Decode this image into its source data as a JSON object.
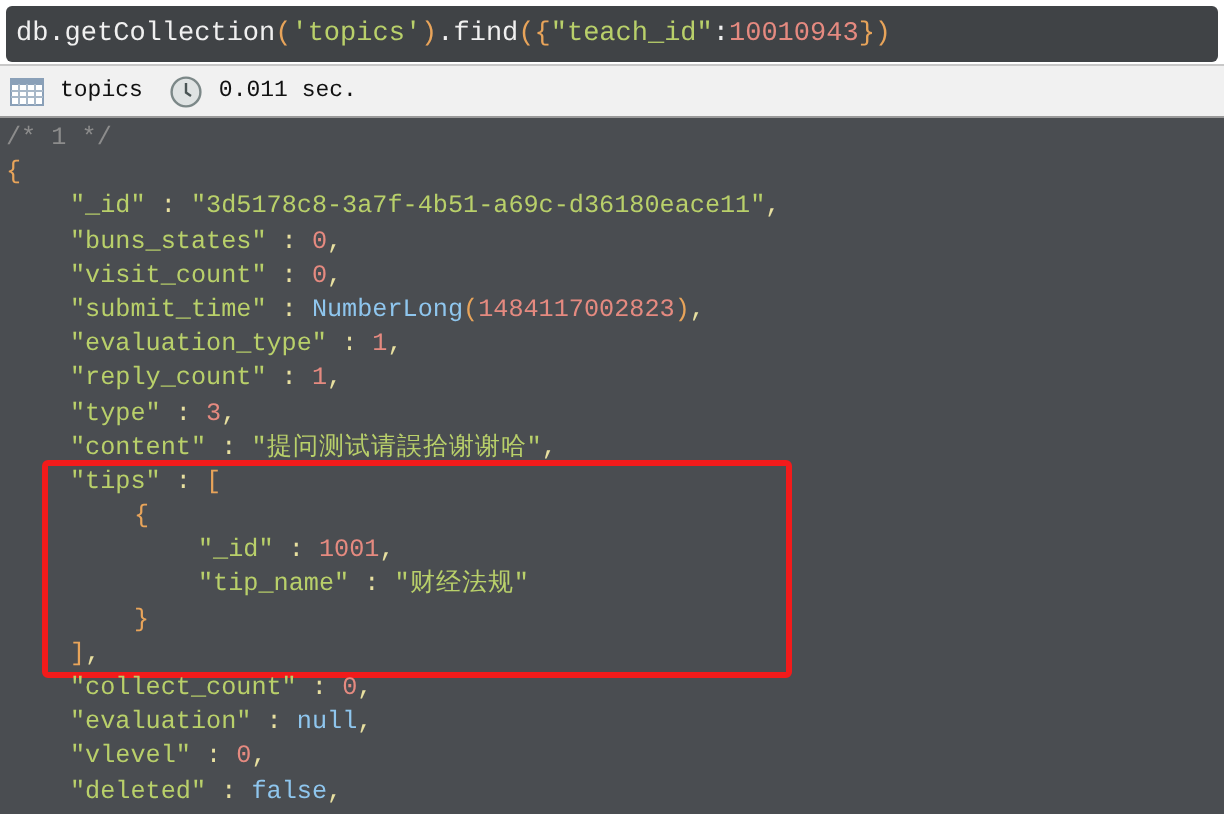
{
  "query": {
    "tokens": [
      {
        "kind": "ident",
        "text": "db.getCollection"
      },
      {
        "kind": "bracket",
        "text": "("
      },
      {
        "kind": "string",
        "text": "'topics'"
      },
      {
        "kind": "bracket",
        "text": ")"
      },
      {
        "kind": "ident",
        "text": ".find"
      },
      {
        "kind": "bracket",
        "text": "({"
      },
      {
        "kind": "string",
        "text": "\"teach_id\""
      },
      {
        "kind": "ident",
        "text": ":"
      },
      {
        "kind": "number",
        "text": "10010943"
      },
      {
        "kind": "bracket",
        "text": "})"
      }
    ]
  },
  "status_bar": {
    "collection": "topics",
    "time": "0.011 sec."
  },
  "document": [
    {
      "kind": "line",
      "tokens": [
        {
          "kind": "comment",
          "text": "/* 1 */"
        }
      ]
    },
    {
      "kind": "line",
      "tokens": [
        {
          "kind": "bracket",
          "text": "{"
        }
      ],
      "children": [
        {
          "kind": "line",
          "tokens": [
            {
              "kind": "key",
              "text": "\"_id\""
            },
            {
              "kind": "punct",
              "text": " : "
            },
            {
              "kind": "string",
              "text": "\"3d5178c8-3a7f-4b51-a69c-d36180eace11\""
            },
            {
              "kind": "punct",
              "text": ","
            }
          ]
        },
        {
          "kind": "line",
          "tokens": [
            {
              "kind": "key",
              "text": "\"buns_states\""
            },
            {
              "kind": "punct",
              "text": " : "
            },
            {
              "kind": "number",
              "text": "0"
            },
            {
              "kind": "punct",
              "text": ","
            }
          ]
        },
        {
          "kind": "line",
          "tokens": [
            {
              "kind": "key",
              "text": "\"visit_count\""
            },
            {
              "kind": "punct",
              "text": " : "
            },
            {
              "kind": "number",
              "text": "0"
            },
            {
              "kind": "punct",
              "text": ","
            }
          ]
        },
        {
          "kind": "line",
          "tokens": [
            {
              "kind": "key",
              "text": "\"submit_time\""
            },
            {
              "kind": "punct",
              "text": " : "
            },
            {
              "kind": "call",
              "text": "NumberLong"
            },
            {
              "kind": "bracket",
              "text": "("
            },
            {
              "kind": "number",
              "text": "1484117002823"
            },
            {
              "kind": "bracket",
              "text": ")"
            },
            {
              "kind": "punct",
              "text": ","
            }
          ]
        },
        {
          "kind": "line",
          "tokens": [
            {
              "kind": "key",
              "text": "\"evaluation_type\""
            },
            {
              "kind": "punct",
              "text": " : "
            },
            {
              "kind": "number",
              "text": "1"
            },
            {
              "kind": "punct",
              "text": ","
            }
          ]
        },
        {
          "kind": "line",
          "tokens": [
            {
              "kind": "key",
              "text": "\"reply_count\""
            },
            {
              "kind": "punct",
              "text": " : "
            },
            {
              "kind": "number",
              "text": "1"
            },
            {
              "kind": "punct",
              "text": ","
            }
          ]
        },
        {
          "kind": "line",
          "tokens": [
            {
              "kind": "key",
              "text": "\"type\""
            },
            {
              "kind": "punct",
              "text": " : "
            },
            {
              "kind": "number",
              "text": "3"
            },
            {
              "kind": "punct",
              "text": ","
            }
          ]
        },
        {
          "kind": "line",
          "tokens": [
            {
              "kind": "key",
              "text": "\"content\""
            },
            {
              "kind": "punct",
              "text": " : "
            },
            {
              "kind": "string",
              "text": "\"提问测试请誤拾谢谢哈\""
            },
            {
              "kind": "punct",
              "text": ","
            }
          ]
        },
        {
          "kind": "frame",
          "children": [
            {
              "kind": "line",
              "tokens": [
                {
                  "kind": "key",
                  "text": "\"tips\""
                },
                {
                  "kind": "punct",
                  "text": " : "
                },
                {
                  "kind": "bracket",
                  "text": "["
                }
              ],
              "children": [
                {
                  "kind": "line",
                  "tokens": [
                    {
                      "kind": "bracket",
                      "text": "{"
                    }
                  ],
                  "children": [
                    {
                      "kind": "line",
                      "tokens": [
                        {
                          "kind": "key",
                          "text": "\"_id\""
                        },
                        {
                          "kind": "punct",
                          "text": " : "
                        },
                        {
                          "kind": "number",
                          "text": "1001"
                        },
                        {
                          "kind": "punct",
                          "text": ","
                        }
                      ]
                    },
                    {
                      "kind": "line",
                      "tokens": [
                        {
                          "kind": "key",
                          "text": "\"tip_name\""
                        },
                        {
                          "kind": "punct",
                          "text": " : "
                        },
                        {
                          "kind": "string",
                          "text": "\"财经法规\""
                        }
                      ]
                    }
                  ]
                },
                {
                  "kind": "line",
                  "tokens": [
                    {
                      "kind": "bracket",
                      "text": "}"
                    }
                  ]
                }
              ]
            },
            {
              "kind": "line",
              "tokens": [
                {
                  "kind": "bracket",
                  "text": "]"
                },
                {
                  "kind": "punct",
                  "text": ","
                }
              ]
            }
          ]
        },
        {
          "kind": "line",
          "tokens": [
            {
              "kind": "key",
              "text": "\"collect_count\""
            },
            {
              "kind": "punct",
              "text": " : "
            },
            {
              "kind": "number",
              "text": "0"
            },
            {
              "kind": "punct",
              "text": ","
            }
          ]
        },
        {
          "kind": "line",
          "tokens": [
            {
              "kind": "key",
              "text": "\"evaluation\""
            },
            {
              "kind": "punct",
              "text": " : "
            },
            {
              "kind": "literal",
              "text": "null"
            },
            {
              "kind": "punct",
              "text": ","
            }
          ]
        },
        {
          "kind": "line",
          "tokens": [
            {
              "kind": "key",
              "text": "\"vlevel\""
            },
            {
              "kind": "punct",
              "text": " : "
            },
            {
              "kind": "number",
              "text": "0"
            },
            {
              "kind": "punct",
              "text": ","
            }
          ]
        },
        {
          "kind": "line",
          "tokens": [
            {
              "kind": "key",
              "text": "\"deleted\""
            },
            {
              "kind": "punct",
              "text": " : "
            },
            {
              "kind": "literal",
              "text": "false"
            },
            {
              "kind": "punct",
              "text": ","
            }
          ]
        }
      ]
    }
  ]
}
